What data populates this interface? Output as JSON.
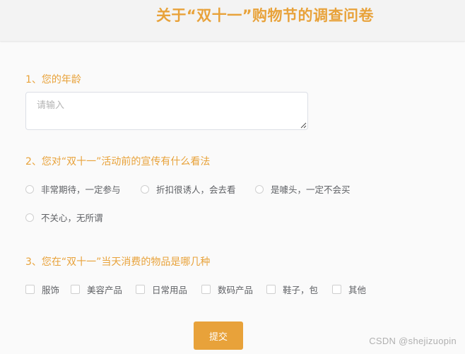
{
  "header": {
    "title": "关于“双十一”购物节的调查问卷"
  },
  "form": {
    "questions": [
      {
        "label": "1、您的年龄",
        "placeholder": "请输入",
        "value": ""
      },
      {
        "label": "2、您对“双十一”活动前的宣传有什么看法",
        "options": [
          "非常期待，一定参与",
          "折扣很诱人，会去看",
          "是噱头，一定不会买",
          "不关心，无所谓"
        ],
        "selected": null
      },
      {
        "label": "3、您在“双十一”当天消费的物品是哪几种",
        "options": [
          "服饰",
          "美容产品",
          "日常用品",
          "数码产品",
          "鞋子，包",
          "其他"
        ],
        "checked": []
      }
    ],
    "submit_label": "提交"
  },
  "watermark": "CSDN @shejizuopin",
  "colors": {
    "accent": "#e8a23a",
    "background": "#fafafa",
    "header_background": "#f3f3f3",
    "option_text": "#606266",
    "border": "#cfcfcf"
  }
}
